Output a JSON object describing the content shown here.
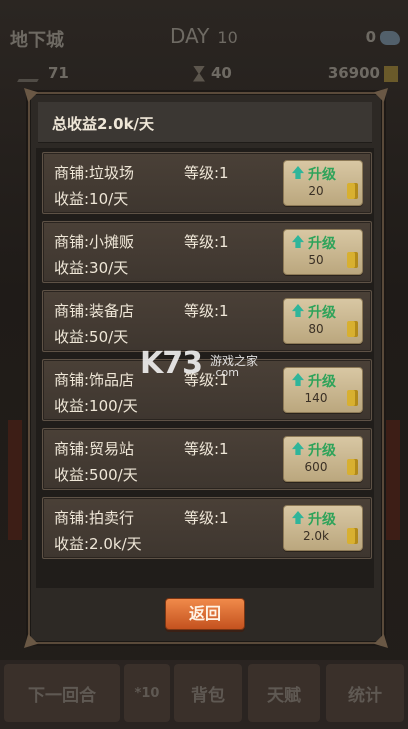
{
  "hud": {
    "title": "地下城",
    "day_label": "DAY",
    "day_value": "10",
    "gems": "0",
    "attack": "71",
    "time": "40",
    "gold": "36900"
  },
  "bottom_bar": {
    "next_turn": "下一回合",
    "x10": "*10",
    "bag": "背包",
    "talent": "天赋",
    "stats": "统计"
  },
  "modal": {
    "title": "总收益2.0k/天",
    "upgrade_label": "升级",
    "back_label": "返回",
    "shops": [
      {
        "name": "商铺:垃圾场",
        "level": "等级:1",
        "income": "收益:10/天",
        "cost": "20"
      },
      {
        "name": "商铺:小摊贩",
        "level": "等级:1",
        "income": "收益:30/天",
        "cost": "50"
      },
      {
        "name": "商铺:装备店",
        "level": "等级:1",
        "income": "收益:50/天",
        "cost": "80"
      },
      {
        "name": "商铺:饰品店",
        "level": "等级:1",
        "income": "收益:100/天",
        "cost": "140"
      },
      {
        "name": "商铺:贸易站",
        "level": "等级:1",
        "income": "收益:500/天",
        "cost": "600"
      },
      {
        "name": "商铺:拍卖行",
        "level": "等级:1",
        "income": "收益:2.0k/天",
        "cost": "2.0k"
      }
    ]
  },
  "watermark": {
    "big": "K73",
    "small": "游戏之家",
    "com": ".com"
  },
  "colors": {
    "upgrade_green": "#2ea35a",
    "back_orange": "#e2743a",
    "coin_gold": "#d8b030"
  }
}
